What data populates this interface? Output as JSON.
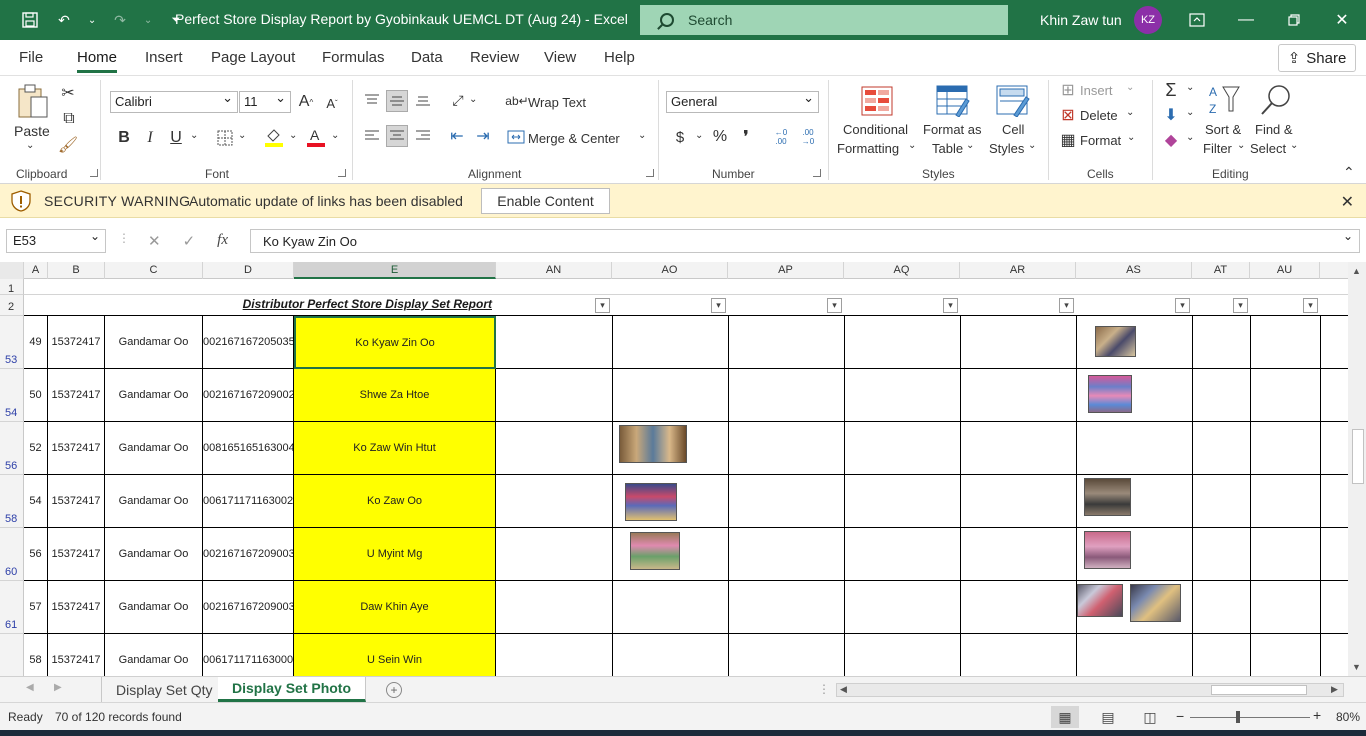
{
  "titlebar": {
    "title": "Perfect Store Display Report by Gyobinkauk  UEMCL DT (Aug 24)  -  Excel",
    "search_placeholder": "Search",
    "user_name": "Khin Zaw tun",
    "user_initials": "KZ",
    "accent_color": "#217346"
  },
  "menu": {
    "tabs": [
      "File",
      "Home",
      "Insert",
      "Page Layout",
      "Formulas",
      "Data",
      "Review",
      "View",
      "Help"
    ],
    "active_tab": "Home",
    "share_label": "Share"
  },
  "ribbon": {
    "clipboard": {
      "paste_label": "Paste",
      "group_label": "Clipboard"
    },
    "font": {
      "font_name": "Calibri",
      "font_size": "11",
      "bold": "B",
      "italic": "I",
      "underline": "U",
      "group_label": "Font"
    },
    "alignment": {
      "wrap_text": "Wrap Text",
      "merge_center": "Merge & Center",
      "group_label": "Alignment"
    },
    "number": {
      "format": "General",
      "currency": "$",
      "percent": "%",
      "comma": "❜",
      "group_label": "Number"
    },
    "styles": {
      "conditional_1": "Conditional",
      "conditional_2": "Formatting",
      "format_table_1": "Format as",
      "format_table_2": "Table",
      "cell_styles_1": "Cell",
      "cell_styles_2": "Styles",
      "group_label": "Styles"
    },
    "cells": {
      "insert": "Insert",
      "delete": "Delete",
      "format": "Format",
      "group_label": "Cells"
    },
    "editing": {
      "sort_filter_1": "Sort &",
      "sort_filter_2": "Filter",
      "find_select_1": "Find &",
      "find_select_2": "Select",
      "group_label": "Editing"
    }
  },
  "security": {
    "title": "SECURITY WARNING",
    "message": "Automatic update of links has been disabled",
    "button": "Enable Content"
  },
  "formula_bar": {
    "name_box": "E53",
    "formula": "Ko Kyaw Zin Oo"
  },
  "sheet": {
    "columns": [
      "A",
      "B",
      "C",
      "D",
      "E",
      "AN",
      "AO",
      "AP",
      "AQ",
      "AR",
      "AS",
      "AT",
      "AU"
    ],
    "selected_column": "E",
    "report_title": "Distributor Perfect Store Display Set Report",
    "rows": [
      {
        "row_num": "53",
        "a": "49",
        "b": "15372417",
        "c": "Gandamar Oo",
        "d": "002167167205035",
        "e": "Ko Kyaw Zin Oo"
      },
      {
        "row_num": "54",
        "a": "50",
        "b": "15372417",
        "c": "Gandamar Oo",
        "d": "002167167209002",
        "e": "Shwe Za Htoe"
      },
      {
        "row_num": "56",
        "a": "52",
        "b": "15372417",
        "c": "Gandamar Oo",
        "d": "008165165163004",
        "e": "Ko Zaw Win Htut"
      },
      {
        "row_num": "58",
        "a": "54",
        "b": "15372417",
        "c": "Gandamar Oo",
        "d": "006171171163002",
        "e": "Ko Zaw Oo"
      },
      {
        "row_num": "60",
        "a": "56",
        "b": "15372417",
        "c": "Gandamar Oo",
        "d": "002167167209003",
        "e": "U Myint Mg"
      },
      {
        "row_num": "61",
        "a": "57",
        "b": "15372417",
        "c": "Gandamar Oo",
        "d": "002167167209003",
        "e": "Daw Khin Aye"
      },
      {
        "row_num": "",
        "a": "58",
        "b": "15372417",
        "c": "Gandamar Oo",
        "d": "006171171163000",
        "e": "U Sein Win"
      }
    ]
  },
  "sheet_tabs": {
    "tabs": [
      "Display Set Qty",
      "Display Set Photo"
    ],
    "active": "Display Set Photo"
  },
  "status": {
    "ready": "Ready",
    "records": "70 of 120 records found",
    "zoom": "80%"
  }
}
